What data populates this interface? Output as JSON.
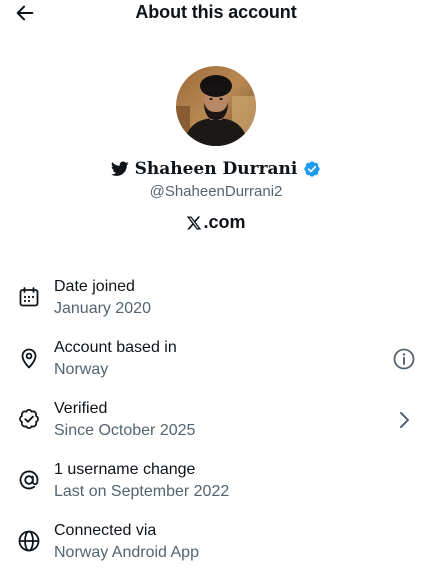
{
  "header": {
    "title": "About this account",
    "back_icon": "arrow-left-icon"
  },
  "profile": {
    "display_name": "Shaheen Durrani",
    "handle": "@ShaheenDurrani2",
    "name_prefix_icon": "twitter-bird-icon",
    "verified_badge_color": "#1d9bf0",
    "site_label": ".com",
    "site_logo": "x-logo-icon"
  },
  "rows": [
    {
      "title": "Date joined",
      "subtitle": "January 2020",
      "icon": "calendar-icon"
    },
    {
      "title": "Account based in",
      "subtitle": "Norway",
      "icon": "location-pin-icon",
      "trailing_icon": "info-icon"
    },
    {
      "title": "Verified",
      "subtitle": "Since October 2025",
      "icon": "verified-outline-icon",
      "trailing_icon": "chevron-right-icon"
    },
    {
      "title": "1 username change",
      "subtitle": "Last on September 2022",
      "icon": "at-sign-icon"
    },
    {
      "title": "Connected via",
      "subtitle": "Norway Android App",
      "icon": "globe-icon"
    }
  ],
  "colors": {
    "text_primary": "#0f1419",
    "text_secondary": "#536471",
    "background": "#ffffff",
    "accent": "#1d9bf0"
  }
}
